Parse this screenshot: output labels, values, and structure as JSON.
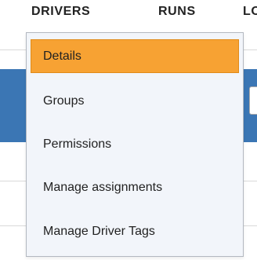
{
  "nav": {
    "items": [
      {
        "label": "DRIVERS"
      },
      {
        "label": "RUNS"
      },
      {
        "label": "LO"
      }
    ]
  },
  "dropdown": {
    "items": [
      {
        "label": "Details",
        "active": true
      },
      {
        "label": "Groups"
      },
      {
        "label": "Permissions"
      },
      {
        "label": "Manage assignments"
      },
      {
        "label": "Manage Driver Tags"
      }
    ]
  },
  "colors": {
    "accent": "#f7a233",
    "band": "#3b76b4",
    "menu_bg": "#f2f5fa"
  }
}
